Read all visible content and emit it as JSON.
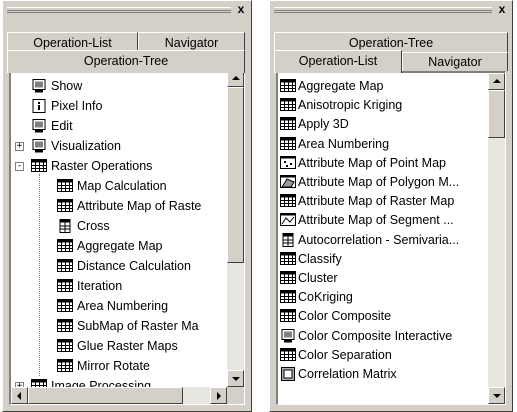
{
  "left_panel": {
    "close_glyph": "x",
    "tabs": {
      "operation_list": "Operation-List",
      "navigator": "Navigator",
      "operation_tree": "Operation-Tree"
    },
    "tree": [
      {
        "label": "Show",
        "icon": "monitor-icon",
        "level": 0
      },
      {
        "label": "Pixel Info",
        "icon": "info-icon",
        "level": 0
      },
      {
        "label": "Edit",
        "icon": "monitor-icon",
        "level": 0
      },
      {
        "label": "Visualization",
        "icon": "monitor-icon",
        "level": 0,
        "expander": "+"
      },
      {
        "label": "Raster Operations",
        "icon": "raster-map-icon",
        "level": 0,
        "expander": "-"
      },
      {
        "label": "Map Calculation",
        "icon": "raster-map-icon",
        "level": 1
      },
      {
        "label": "Attribute Map of Raste",
        "icon": "raster-map-icon",
        "level": 1
      },
      {
        "label": "Cross",
        "icon": "table-icon",
        "level": 1
      },
      {
        "label": "Aggregate Map",
        "icon": "raster-map-icon",
        "level": 1
      },
      {
        "label": "Distance Calculation",
        "icon": "raster-map-icon",
        "level": 1
      },
      {
        "label": "Iteration",
        "icon": "raster-map-icon",
        "level": 1
      },
      {
        "label": "Area Numbering",
        "icon": "raster-map-icon",
        "level": 1
      },
      {
        "label": "SubMap of Raster Ma",
        "icon": "raster-map-icon",
        "level": 1
      },
      {
        "label": "Glue Raster Maps",
        "icon": "raster-map-icon",
        "level": 1
      },
      {
        "label": "Mirror Rotate",
        "icon": "raster-map-icon",
        "level": 1
      },
      {
        "label": "Image Processing",
        "icon": "raster-map-icon",
        "level": 0,
        "expander": "+"
      }
    ]
  },
  "right_panel": {
    "close_glyph": "x",
    "tabs": {
      "operation_tree": "Operation-Tree",
      "operation_list": "Operation-List",
      "navigator": "Navigator"
    },
    "list": [
      {
        "label": "Aggregate Map",
        "icon": "raster-map-icon"
      },
      {
        "label": "Anisotropic Kriging",
        "icon": "raster-map-icon"
      },
      {
        "label": "Apply 3D",
        "icon": "raster-map-icon"
      },
      {
        "label": "Area Numbering",
        "icon": "raster-map-icon"
      },
      {
        "label": "Attribute Map of Point Map",
        "icon": "point-map-icon"
      },
      {
        "label": "Attribute Map of Polygon M...",
        "icon": "polygon-map-icon"
      },
      {
        "label": "Attribute Map of Raster Map",
        "icon": "raster-map-icon"
      },
      {
        "label": "Attribute Map of Segment ...",
        "icon": "segment-map-icon"
      },
      {
        "label": "Autocorrelation - Semivaria...",
        "icon": "table-icon"
      },
      {
        "label": "Classify",
        "icon": "raster-map-icon"
      },
      {
        "label": "Cluster",
        "icon": "raster-map-icon"
      },
      {
        "label": "CoKriging",
        "icon": "raster-map-icon"
      },
      {
        "label": "Color Composite",
        "icon": "raster-map-icon"
      },
      {
        "label": "Color Composite Interactive",
        "icon": "monitor-icon"
      },
      {
        "label": "Color Separation",
        "icon": "raster-map-icon"
      },
      {
        "label": "Correlation Matrix",
        "icon": "matrix-icon"
      }
    ]
  }
}
